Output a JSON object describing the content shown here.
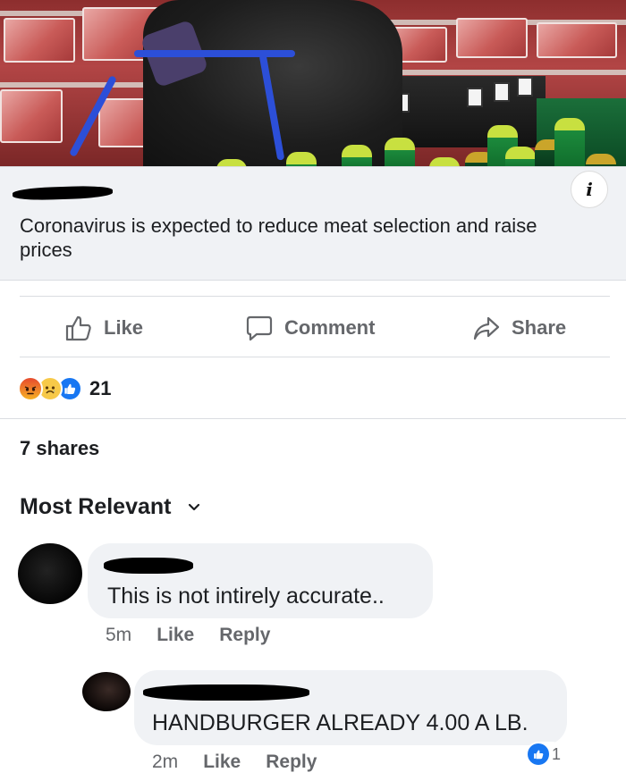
{
  "post": {
    "link_title": "Coronavirus is expected to reduce meat selection and raise prices",
    "info_icon": "info-icon"
  },
  "actions": {
    "like_label": "Like",
    "comment_label": "Comment",
    "share_label": "Share"
  },
  "reactions": {
    "types": [
      "angry",
      "sad",
      "like"
    ],
    "count": "21"
  },
  "shares_text": "7 shares",
  "sort_label": "Most Relevant",
  "comments": [
    {
      "text": "This is not intirely accurate..",
      "time": "5m",
      "like_label": "Like",
      "reply_label": "Reply"
    },
    {
      "text": "HANDBURGER ALREADY 4.00 A LB.",
      "time": "2m",
      "like_label": "Like",
      "reply_label": "Reply",
      "like_count": "1"
    }
  ],
  "colors": {
    "facebook_blue": "#1877f2",
    "action_gray": "#65676b",
    "card_bg": "#f0f2f5"
  }
}
